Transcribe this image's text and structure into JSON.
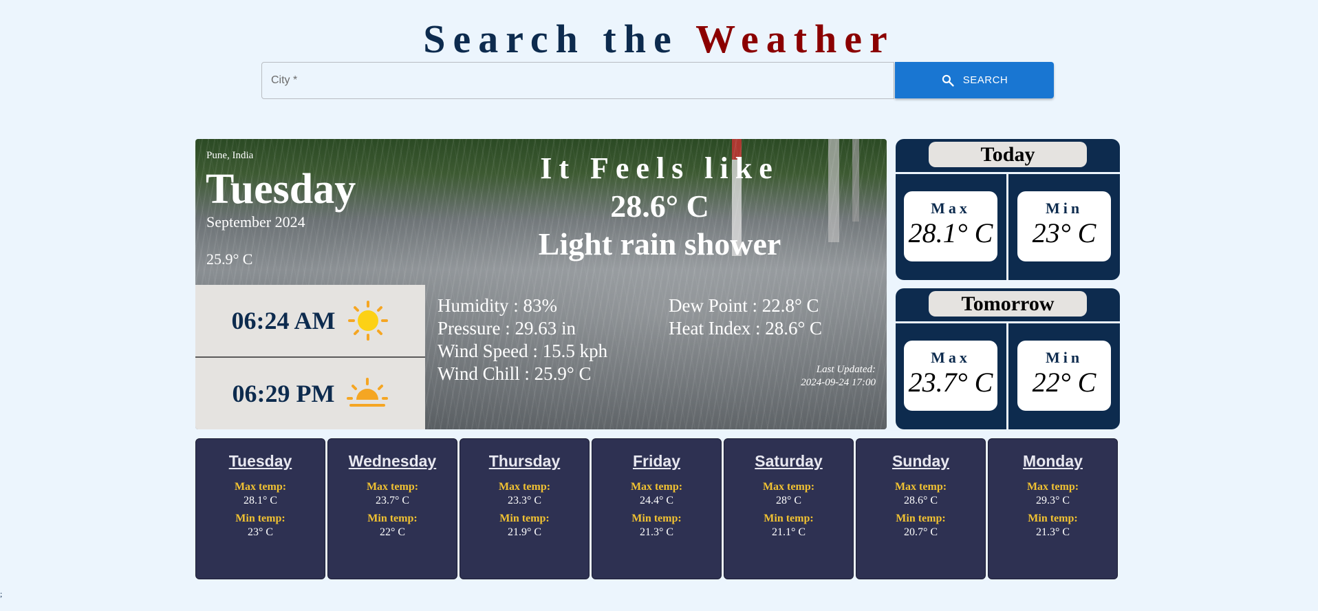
{
  "header": {
    "title_part1": "Search the",
    "title_part2": "Weather"
  },
  "search": {
    "placeholder": "City *",
    "value": "",
    "button_label": "SEARCH"
  },
  "current": {
    "location": "Pune, India",
    "day": "Tuesday",
    "month_year": "September 2024",
    "temperature": "25.9° C",
    "feels_like_label": "It Feels like",
    "feels_like_value": "28.6° C",
    "condition": "Light rain shower",
    "sunrise": "06:24 AM",
    "sunset": "06:29 PM",
    "humidity": "Humidity : 83%",
    "pressure": "Pressure : 29.63 in",
    "wind_speed": "Wind Speed : 15.5 kph",
    "wind_chill": "Wind Chill : 25.9° C",
    "dew_point": "Dew Point : 22.8° C",
    "heat_index": "Heat Index : 28.6° C",
    "last_updated_label": "Last Updated:",
    "last_updated_value": "2024-09-24 17:00"
  },
  "today": {
    "title": "Today",
    "max_label": "Max",
    "max_value": "28.1° C",
    "min_label": "Min",
    "min_value": "23° C"
  },
  "tomorrow": {
    "title": "Tomorrow",
    "max_label": "Max",
    "max_value": "23.7° C",
    "min_label": "Min",
    "min_value": "22° C"
  },
  "forecast": {
    "max_label": "Max temp:",
    "min_label": "Min temp:",
    "days": [
      {
        "day": "Tuesday",
        "max": "28.1° C",
        "min": "23° C"
      },
      {
        "day": "Wednesday",
        "max": "23.7° C",
        "min": "22° C"
      },
      {
        "day": "Thursday",
        "max": "23.3° C",
        "min": "21.9° C"
      },
      {
        "day": "Friday",
        "max": "24.4° C",
        "min": "21.3° C"
      },
      {
        "day": "Saturday",
        "max": "28° C",
        "min": "21.1° C"
      },
      {
        "day": "Sunday",
        "max": "28.6° C",
        "min": "20.7° C"
      },
      {
        "day": "Monday",
        "max": "29.3° C",
        "min": "21.3° C"
      }
    ]
  },
  "footer": {
    "stray_text": ";"
  },
  "icons": {
    "search": "search-icon",
    "sunrise": "sun-icon",
    "sunset": "sunset-icon"
  },
  "colors": {
    "navy": "#0d2b4e",
    "maroon": "#8b0000",
    "button_blue": "#1976d2",
    "forecast_bg": "#2e3152",
    "label_yellow": "#f1c232"
  }
}
